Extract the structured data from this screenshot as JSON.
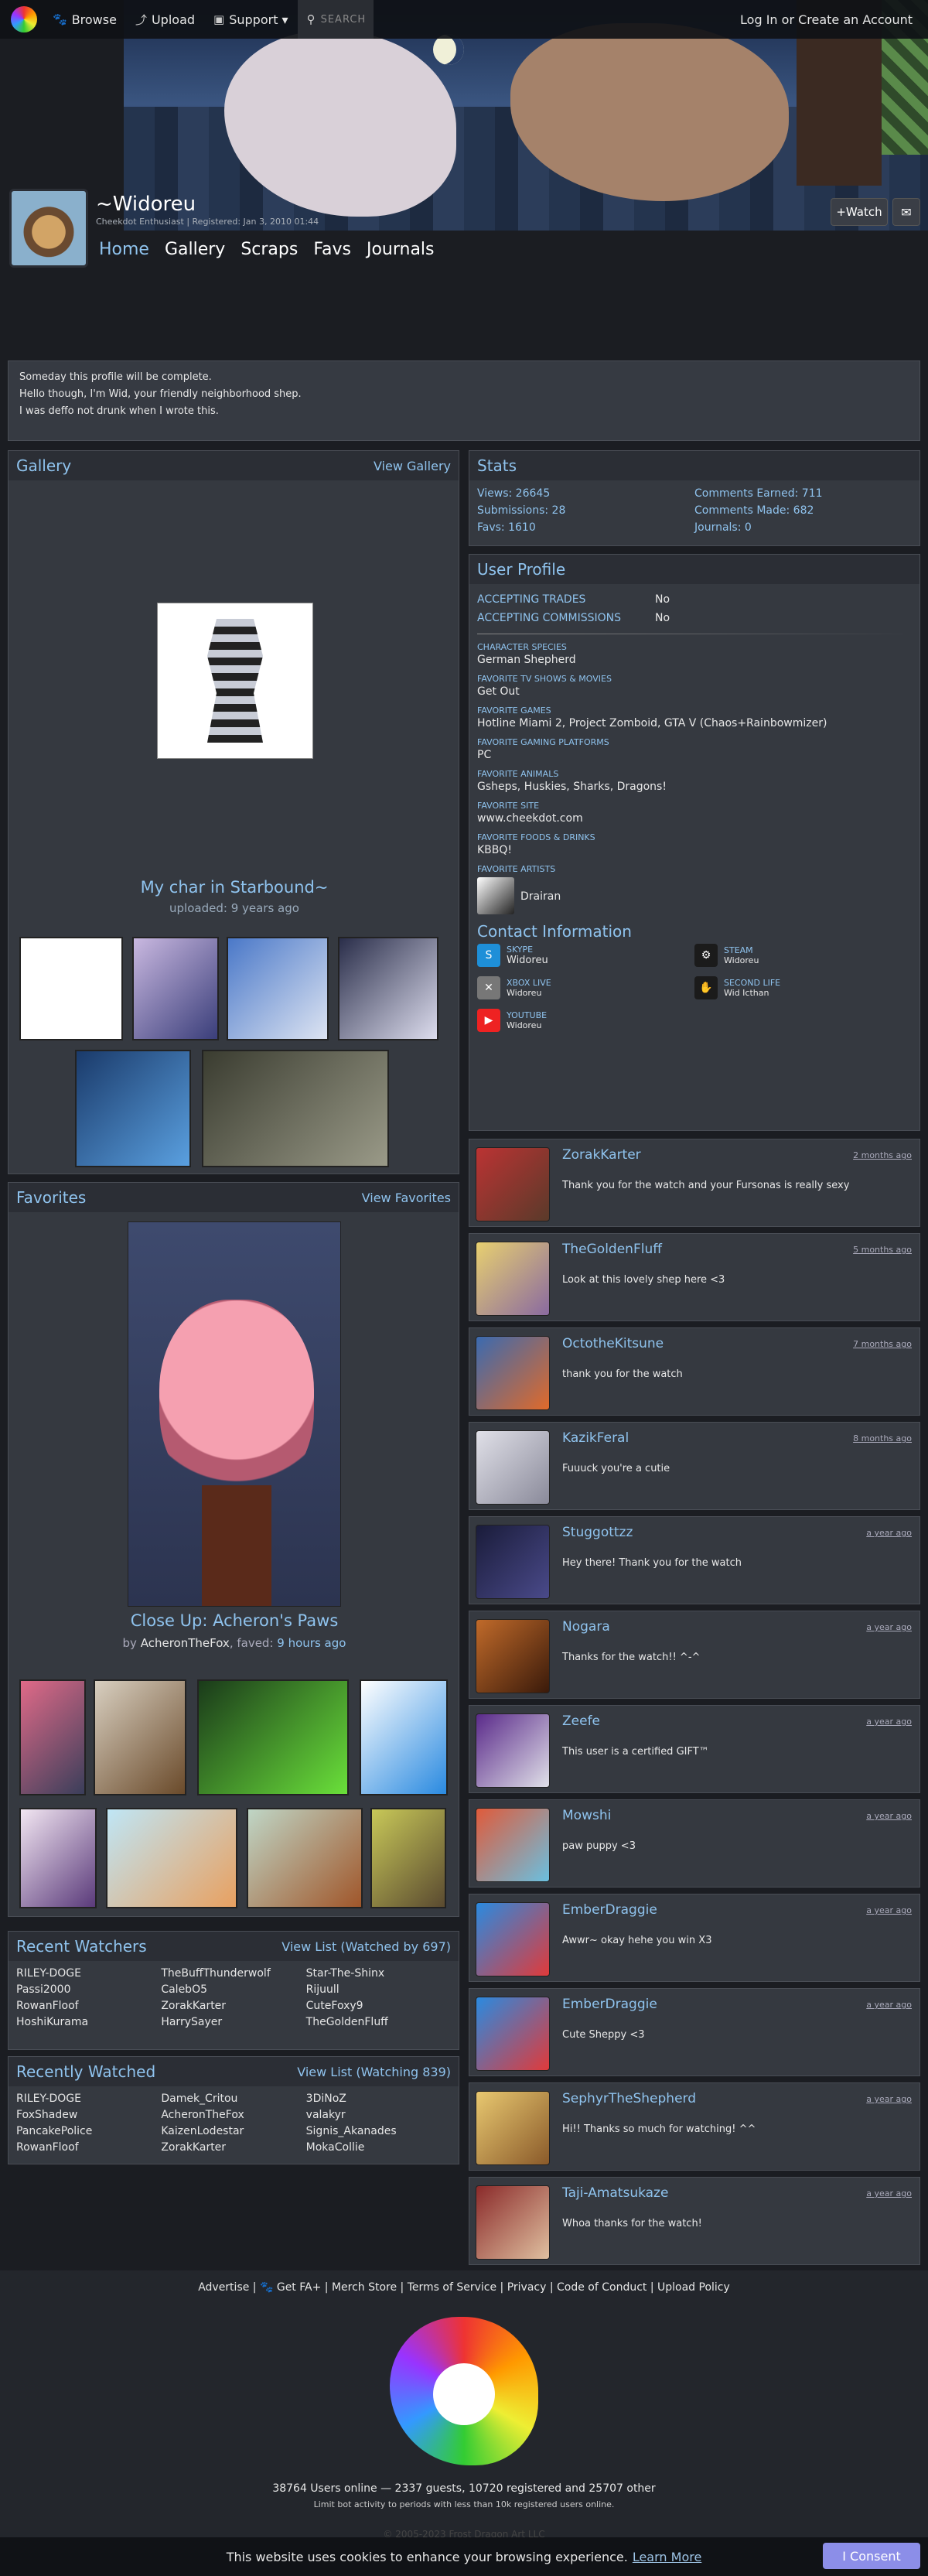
{
  "nav": {
    "browse": "Browse",
    "upload": "Upload",
    "support": "Support ▾",
    "search": "SEARCH",
    "auth": "Log In or Create an Account"
  },
  "user": {
    "name": "~Widoreu",
    "title": "Cheekdot Enthusiast | Registered: Jan 3, 2010 01:44",
    "watch": "+Watch"
  },
  "tabs": [
    "Home",
    "Gallery",
    "Scraps",
    "Favs",
    "Journals"
  ],
  "blurb": [
    "Someday this profile will be complete.",
    "",
    "Hello though, I'm Wid, your friendly neighborhood shep.",
    "I was deffo not drunk when I wrote this."
  ],
  "gallery": {
    "title": "Gallery",
    "link": "View Gallery",
    "featured_title": "My char in Starbound~",
    "uploaded": "uploaded: 9 years ago"
  },
  "stats": {
    "title": "Stats",
    "items": [
      "Views: 26645",
      "Comments Earned: 711",
      "Submissions: 28",
      "Comments Made: 682",
      "Favs: 1610",
      "Journals: 0"
    ]
  },
  "profile": {
    "title": "User Profile",
    "trades_label": "ACCEPTING TRADES",
    "trades_value": "No",
    "comm_label": "ACCEPTING COMMISSIONS",
    "comm_value": "No",
    "fields": [
      [
        "CHARACTER SPECIES",
        "German Shepherd"
      ],
      [
        "FAVORITE TV SHOWS & MOVIES",
        "Get Out"
      ],
      [
        "FAVORITE GAMES",
        "Hotline Miami 2, Project Zomboid, GTA V (Chaos+Rainbowmizer)"
      ],
      [
        "FAVORITE GAMING PLATFORMS",
        "PC"
      ],
      [
        "FAVORITE ANIMALS",
        "Gsheps, Huskies, Sharks, Dragons!"
      ],
      [
        "FAVORITE SITE",
        "www.cheekdot.com"
      ],
      [
        "FAVORITE FOODS & DRINKS",
        "KBBQ!"
      ]
    ],
    "artists_label": "FAVORITE ARTISTS",
    "artist": "Drairan",
    "contact_title": "Contact Information",
    "contacts": [
      [
        "SKYPE",
        "Widoreu"
      ],
      [
        "STEAM",
        "Widoreu"
      ],
      [
        "XBOX LIVE",
        "Widoreu"
      ],
      [
        "SECOND LIFE",
        "Wid Icthan"
      ],
      [
        "YOUTUBE",
        "Widoreu"
      ]
    ]
  },
  "favorites": {
    "title": "Favorites",
    "link": "View Favorites",
    "featured_title": "Close Up: Acheron's Paws",
    "by": "by",
    "artist": "AcheronTheFox",
    "faved": ", faved:",
    "faved_time": "9 hours ago"
  },
  "watchers": {
    "title": "Recent Watchers",
    "link": "View List (Watched by 697)",
    "names": [
      "RILEY-DOGE",
      "TheBuffThunderwolf",
      "Star-The-Shinx",
      "Passi2000",
      "CalebO5",
      "Rijuull",
      "RowanFloof",
      "ZorakKarter",
      "CuteFoxy9",
      "HoshiKurama",
      "HarrySayer",
      "TheGoldenFluff"
    ]
  },
  "watched": {
    "title": "Recently Watched",
    "link": "View List (Watching 839)",
    "names": [
      "RILEY-DOGE",
      "Damek_Critou",
      "3DiNoZ",
      "FoxShadew",
      "AcheronTheFox",
      "valakyr",
      "PancakePolice",
      "KaizenLodestar",
      "Signis_Akanades",
      "RowanFloof",
      "ZorakKarter",
      "MokaCollie"
    ]
  },
  "comments": [
    [
      "ZorakKarter",
      "2 months ago",
      "Thank you for the watch and your Fursonas is really sexy"
    ],
    [
      "TheGoldenFluff",
      "5 months ago",
      "Look at this lovely shep here <3"
    ],
    [
      "OctotheKitsune",
      "7 months ago",
      "thank you for the watch"
    ],
    [
      "KazikFeral",
      "8 months ago",
      "Fuuuck you're a cutie"
    ],
    [
      "Stuggottzz",
      "a year ago",
      "Hey there! Thank you for the watch"
    ],
    [
      "Nogara",
      "a year ago",
      "Thanks for the watch!! ^-^"
    ],
    [
      "Zeefe",
      "a year ago",
      "This user is a certified GIFT™"
    ],
    [
      "Mowshi",
      "a year ago",
      "paw puppy <3"
    ],
    [
      "EmberDraggie",
      "a year ago",
      "Awwr~ okay hehe you win X3"
    ],
    [
      "EmberDraggie",
      "a year ago",
      "Cute Sheppy <3"
    ],
    [
      "SephyrTheShepherd",
      "a year ago",
      "Hi!! Thanks so much for watching! ^^"
    ],
    [
      "Taji-Amatsukaze",
      "a year ago",
      "Whoa thanks for the watch!"
    ]
  ],
  "footer": {
    "links": "Advertise | 🐾 Get FA+ | Merch Store | Terms of Service | Privacy | Code of Conduct | Upload Policy",
    "online": "38764 Users online — 2337 guests, 10720 registered and 25707 other",
    "bot": "Limit bot activity to periods with less than 10k registered users online.",
    "copyright": "© 2005-2023 Frost Dragon Art LLC"
  },
  "cookie": {
    "text": "This website uses cookies to enhance your browsing experience.",
    "link": "Learn More",
    "button": "I Consent"
  },
  "colors": {
    "accent": "#8fc3ee",
    "panel": "#353940",
    "bg": "#1b1d22",
    "consent": "#8c8ee8"
  }
}
